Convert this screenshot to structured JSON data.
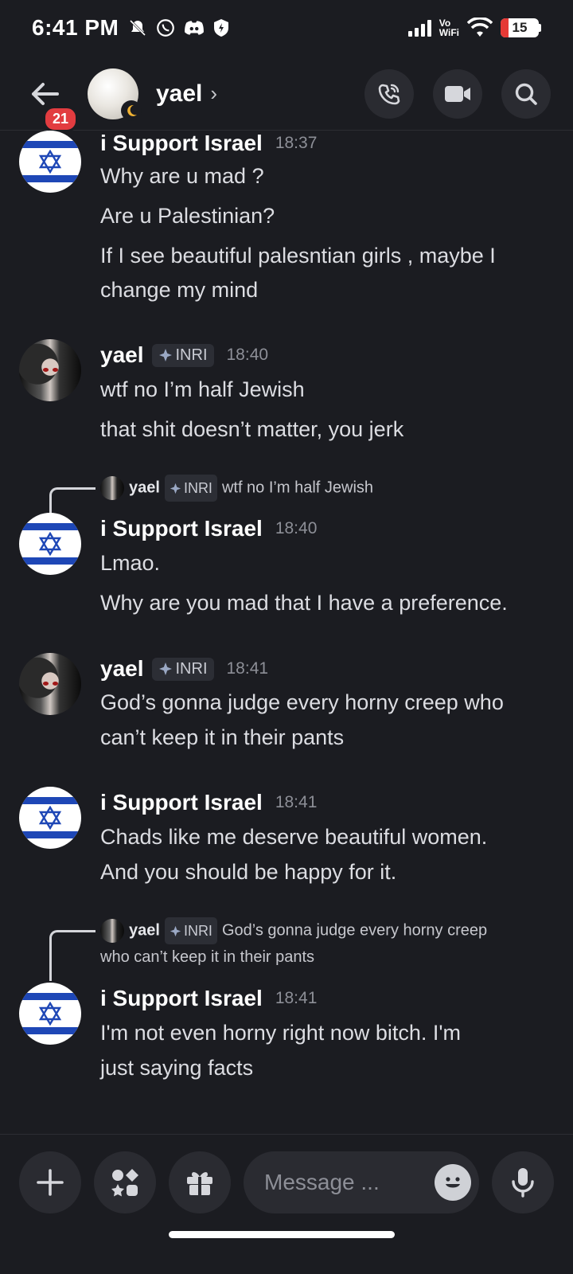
{
  "status_bar": {
    "time": "6:41 PM",
    "network_label_top": "Vo",
    "network_label_bottom": "WiFi",
    "battery": "15"
  },
  "header": {
    "unread_count": "21",
    "contact_name": "yael",
    "chevron": "›"
  },
  "messages": [
    {
      "author": "i Support Israel",
      "time": "18:37",
      "lines": [
        "Why are u mad ?",
        "Are u Palestinian?",
        "If I see beautiful palesntian girls , maybe I",
        "change my mind"
      ]
    },
    {
      "author": "yael",
      "tag": "INRI",
      "time": "18:40",
      "lines": [
        "wtf no I’m half Jewish",
        "that shit doesn’t matter, you jerk"
      ]
    },
    {
      "reply": {
        "author": "yael",
        "tag": "INRI",
        "text": "wtf no I’m half Jewish"
      },
      "author": "i Support Israel",
      "time": "18:40",
      "lines": [
        "Lmao.",
        "Why are you mad that I have a preference."
      ]
    },
    {
      "author": "yael",
      "tag": "INRI",
      "time": "18:41",
      "lines": [
        "God’s gonna judge every horny creep who",
        "can’t keep it in their pants"
      ]
    },
    {
      "author": "i Support Israel",
      "time": "18:41",
      "lines": [
        "Chads like me deserve beautiful women.",
        "And you should be happy for it."
      ]
    },
    {
      "reply": {
        "author": "yael",
        "tag": "INRI",
        "text": "God’s gonna judge every horny creep",
        "text2": "who can’t keep it in their pants"
      },
      "author": "i Support Israel",
      "time": "18:41",
      "lines": [
        "I'm not even horny right now bitch. I'm",
        "just saying facts"
      ]
    }
  ],
  "composer": {
    "placeholder": "Message ..."
  },
  "colors": {
    "background": "#1b1c21",
    "badge_red": "#e23c40",
    "flag_blue": "#1e47b6"
  },
  "icons": [
    "back-arrow-icon",
    "moon-icon",
    "phone-icon",
    "video-camera-icon",
    "search-icon",
    "plus-icon",
    "apps-icon",
    "gift-icon",
    "emoji-icon",
    "microphone-icon",
    "star-of-david-icon",
    "clan-tag-icon"
  ]
}
